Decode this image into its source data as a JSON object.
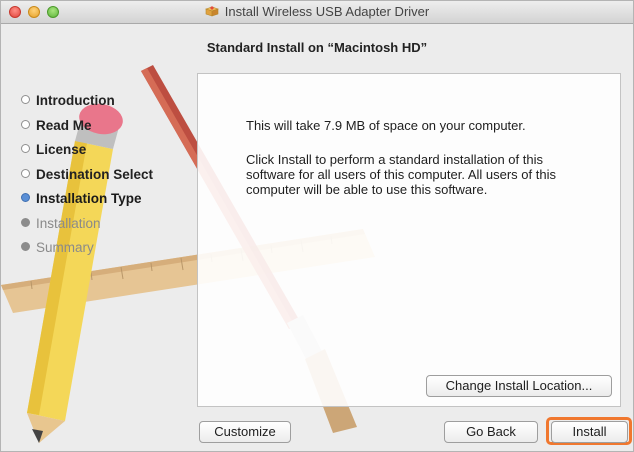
{
  "window": {
    "title": "Install Wireless USB Adapter Driver",
    "subtitle": "Standard Install on “Macintosh HD”"
  },
  "steps": [
    {
      "label": "Introduction",
      "state": "done"
    },
    {
      "label": "Read Me",
      "state": "done"
    },
    {
      "label": "License",
      "state": "done"
    },
    {
      "label": "Destination Select",
      "state": "done"
    },
    {
      "label": "Installation Type",
      "state": "current"
    },
    {
      "label": "Installation",
      "state": "pending"
    },
    {
      "label": "Summary",
      "state": "pending"
    }
  ],
  "content": {
    "space_text": "This will take 7.9 MB of space on your computer.",
    "description": "Click Install to perform a standard installation of this software for all users of this computer. All users of this computer will be able to use this software."
  },
  "buttons": {
    "change_location": "Change Install Location...",
    "customize": "Customize",
    "go_back": "Go Back",
    "install": "Install"
  },
  "colors": {
    "current_step_bullet": "#5a8fd6",
    "install_focus_ring": "#f0772e"
  }
}
